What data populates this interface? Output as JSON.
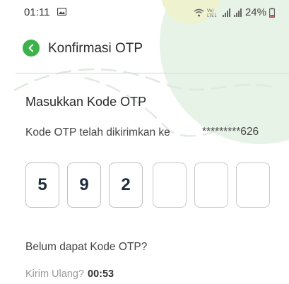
{
  "status_bar": {
    "time": "01:11",
    "network_label": "Vo)\nLTE1",
    "battery_percent": "24%",
    "icons": [
      "gallery-icon",
      "wifi-icon",
      "signal-icon",
      "signal-icon",
      "battery-icon"
    ]
  },
  "header": {
    "title": "Konfirmasi OTP",
    "back_icon": "chevron-left-icon"
  },
  "otp_section": {
    "title": "Masukkan Kode OTP",
    "sent_label": "Kode OTP telah dikirimkan ke",
    "masked_number": "*********626",
    "digits": [
      "5",
      "9",
      "2",
      "",
      "",
      ""
    ]
  },
  "resend": {
    "question": "Belum dapat Kode OTP?",
    "link_label": "Kirim Ulang?",
    "countdown": "00:53"
  },
  "colors": {
    "accent_green": "#3db24b",
    "background_blob": "#e6f3e7",
    "digit_color": "#1e2c3c"
  }
}
